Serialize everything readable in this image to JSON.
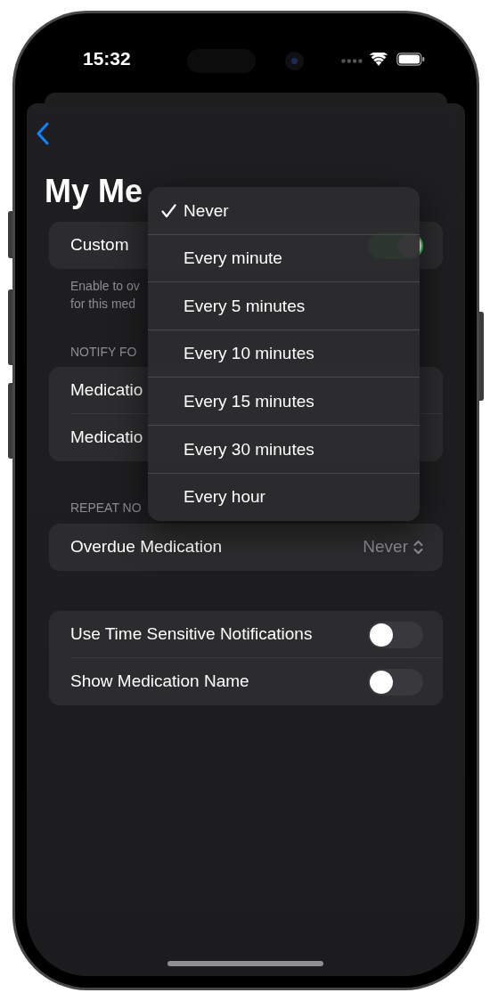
{
  "status_bar": {
    "time": "15:32"
  },
  "title": "My Me",
  "custom": {
    "label": "Custom",
    "on": true
  },
  "footer_lines": [
    "Enable to ov",
    "for this med"
  ],
  "notify_section": {
    "header": "NOTIFY FO",
    "rows": [
      {
        "label": "Medicatio"
      },
      {
        "label": "Medicatio"
      }
    ]
  },
  "repeat_section": {
    "header": "REPEAT NO",
    "rows": [
      {
        "label": "Overdue Medication",
        "value": "Never"
      }
    ]
  },
  "options": [
    {
      "label": "Use Time Sensitive Notifications",
      "on": false
    },
    {
      "label": "Show Medication Name",
      "on": false
    }
  ],
  "menu": {
    "items": [
      {
        "label": "Never",
        "selected": true
      },
      {
        "label": "Every minute",
        "selected": false
      },
      {
        "label": "Every 5 minutes",
        "selected": false
      },
      {
        "label": "Every 10 minutes",
        "selected": false
      },
      {
        "label": "Every 15 minutes",
        "selected": false
      },
      {
        "label": "Every 30 minutes",
        "selected": false
      },
      {
        "label": "Every hour",
        "selected": false
      }
    ]
  }
}
